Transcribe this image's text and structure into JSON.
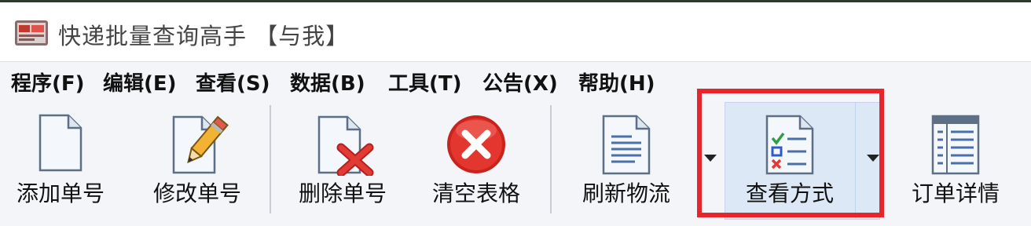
{
  "window": {
    "title": "快递批量查询高手 【与我】",
    "icon": "app-logo-icon"
  },
  "menu": [
    {
      "label": "程序(F)"
    },
    {
      "label": "编辑(E)"
    },
    {
      "label": "查看(S)"
    },
    {
      "label": "数据(B)"
    },
    {
      "label": "工具(T)"
    },
    {
      "label": "公告(X)"
    },
    {
      "label": "帮助(H)"
    }
  ],
  "toolbar": {
    "add": {
      "label": "添加单号",
      "icon": "blank-document-icon"
    },
    "edit": {
      "label": "修改单号",
      "icon": "pencil-document-icon"
    },
    "delete": {
      "label": "删除单号",
      "icon": "document-x-icon"
    },
    "clear": {
      "label": "清空表格",
      "icon": "red-x-circle-icon"
    },
    "refresh": {
      "label": "刷新物流",
      "icon": "text-document-icon"
    },
    "view_mode": {
      "label": "查看方式",
      "icon": "checklist-document-icon"
    },
    "details": {
      "label": "订单详情",
      "icon": "detail-sheet-icon"
    }
  },
  "colors": {
    "highlight_border": "#e8252b",
    "highlight_fill": "#dde8f6"
  }
}
